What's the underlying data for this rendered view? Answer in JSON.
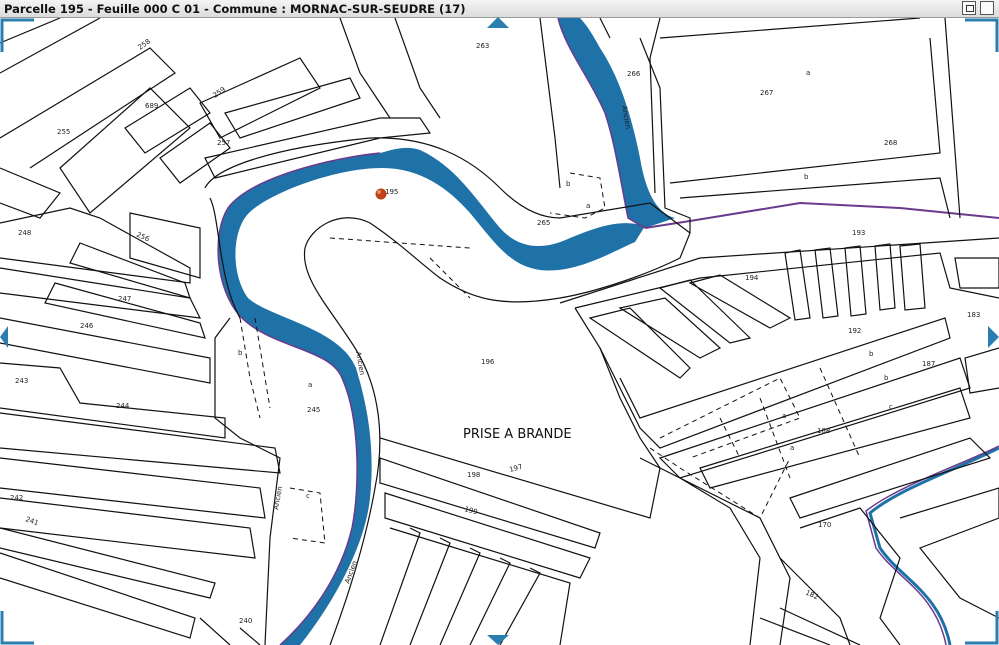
{
  "window": {
    "title": "Parcelle 195 - Feuille 000 C 01 - Commune : MORNAC-SUR-SEUDRE (17)",
    "maximize_icon": "maximize-icon",
    "close_icon": "close-icon"
  },
  "map": {
    "locality": "PRISE A BRANDE",
    "selected_parcel": "195",
    "colors": {
      "water": "#1e72a8",
      "boundary": "#6b3a8c",
      "parcel_line": "#111111",
      "marker": "#c0401a",
      "nav": "#2a7fb0"
    },
    "parcels": [
      "258",
      "259",
      "689",
      "255",
      "257",
      "248",
      "256",
      "247",
      "246",
      "243",
      "244",
      "242",
      "241",
      "245",
      "240",
      "263",
      "266",
      "267",
      "268",
      "265",
      "196",
      "193",
      "194",
      "192",
      "183",
      "187",
      "188",
      "170",
      "182",
      "198",
      "197",
      "199",
      "195"
    ],
    "sub_labels": [
      "a",
      "b",
      "b",
      "a",
      "a",
      "b",
      "c",
      "b",
      "b",
      "c",
      "a",
      "a"
    ],
    "waterway_labels": [
      "Ancien",
      "Ancien",
      "Ancien",
      "Ancien"
    ]
  }
}
